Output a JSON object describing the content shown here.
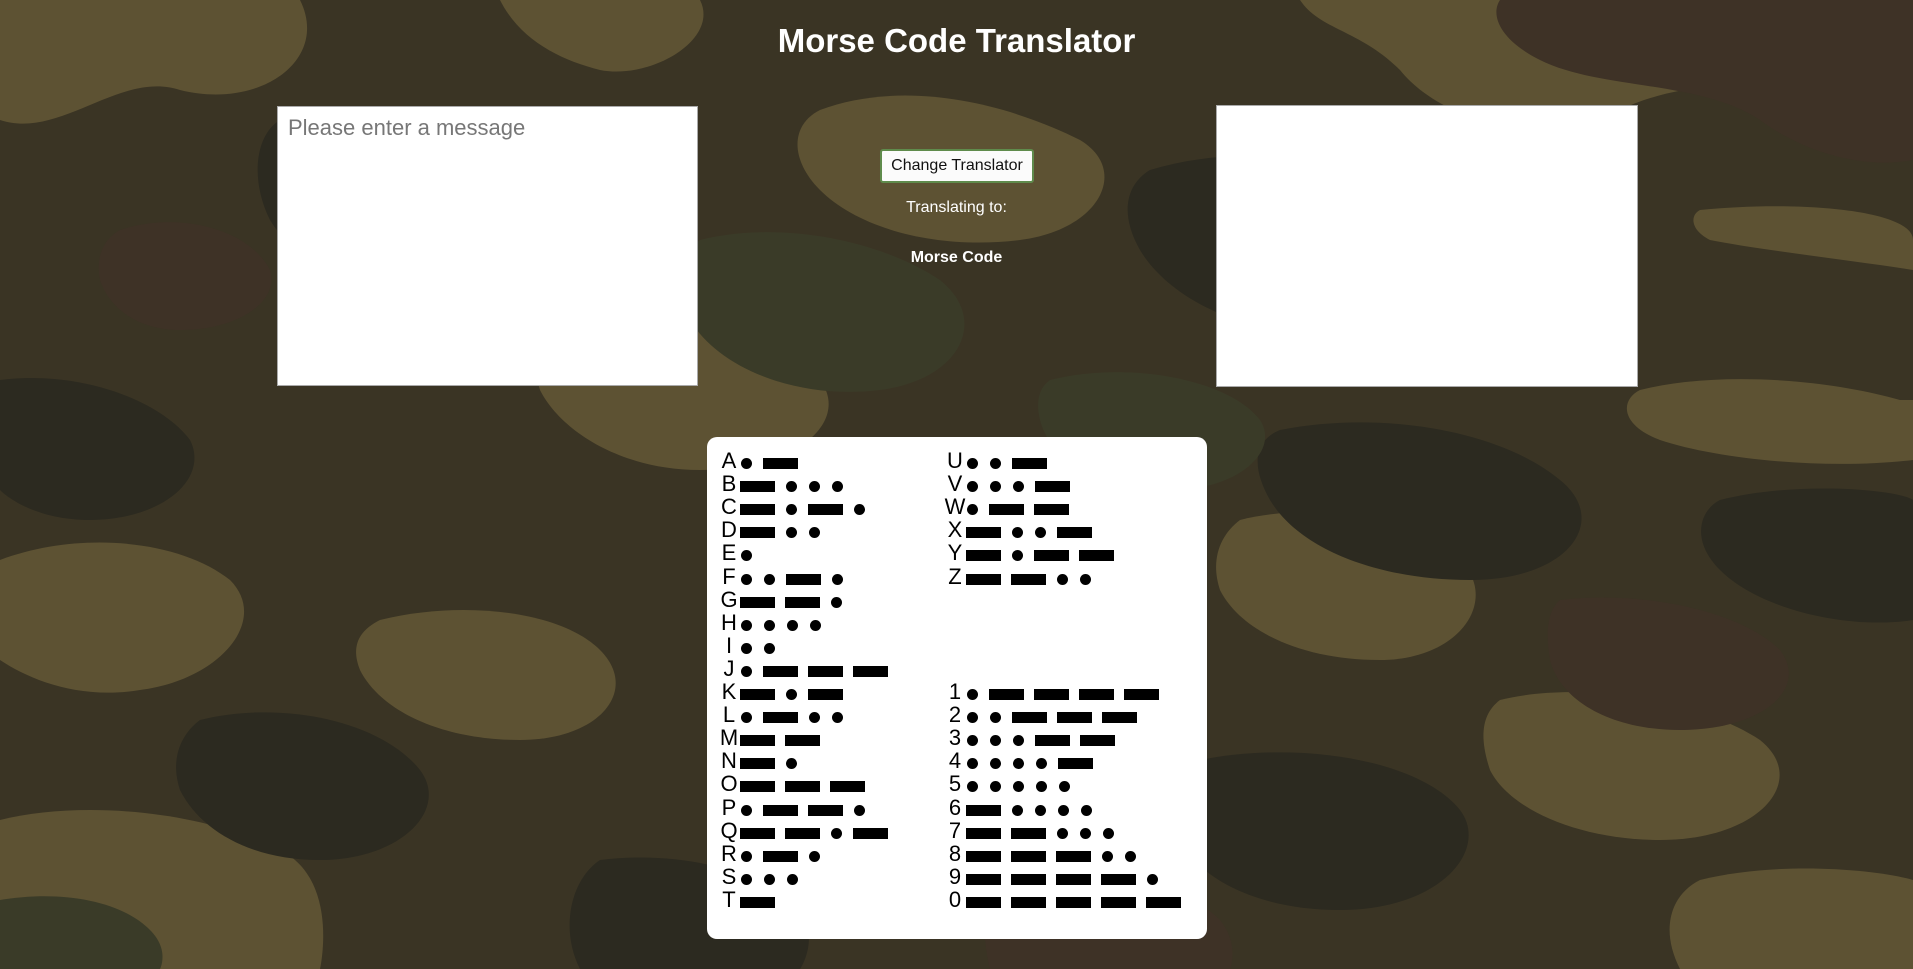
{
  "page": {
    "title": "Morse Code Translator"
  },
  "input": {
    "placeholder": "Please enter a message",
    "value": ""
  },
  "output": {
    "value": ""
  },
  "controls": {
    "change_button_label": "Change Translator",
    "translating_label": "Translating to:",
    "translating_target": "Morse Code"
  },
  "morse_chart": {
    "letters_left": [
      {
        "char": "A",
        "code": ".-"
      },
      {
        "char": "B",
        "code": "-..."
      },
      {
        "char": "C",
        "code": "-.-."
      },
      {
        "char": "D",
        "code": "-.."
      },
      {
        "char": "E",
        "code": "."
      },
      {
        "char": "F",
        "code": "..-."
      },
      {
        "char": "G",
        "code": "--."
      },
      {
        "char": "H",
        "code": "...."
      },
      {
        "char": "I",
        "code": ".."
      },
      {
        "char": "J",
        "code": ".---"
      },
      {
        "char": "K",
        "code": "-.-"
      },
      {
        "char": "L",
        "code": ".-.."
      },
      {
        "char": "M",
        "code": "--"
      },
      {
        "char": "N",
        "code": "-."
      },
      {
        "char": "O",
        "code": "---"
      },
      {
        "char": "P",
        "code": ".--."
      },
      {
        "char": "Q",
        "code": "--.-"
      },
      {
        "char": "R",
        "code": ".-."
      },
      {
        "char": "S",
        "code": "..."
      },
      {
        "char": "T",
        "code": "-"
      }
    ],
    "letters_right": [
      {
        "char": "U",
        "code": "..-"
      },
      {
        "char": "V",
        "code": "...-"
      },
      {
        "char": "W",
        "code": ".--"
      },
      {
        "char": "X",
        "code": "-..-"
      },
      {
        "char": "Y",
        "code": "-.--"
      },
      {
        "char": "Z",
        "code": "--.."
      }
    ],
    "digits": [
      {
        "char": "1",
        "code": ".----"
      },
      {
        "char": "2",
        "code": "..---"
      },
      {
        "char": "3",
        "code": "...--"
      },
      {
        "char": "4",
        "code": "....-"
      },
      {
        "char": "5",
        "code": "....."
      },
      {
        "char": "6",
        "code": "-...."
      },
      {
        "char": "7",
        "code": "--..."
      },
      {
        "char": "8",
        "code": "---.."
      },
      {
        "char": "9",
        "code": "----."
      },
      {
        "char": "0",
        "code": "-----"
      }
    ]
  },
  "colors": {
    "camo_base": "#3a3424",
    "camo_olive": "#5d5233",
    "camo_dark": "#2c2a20",
    "camo_brown": "#3e3226",
    "camo_green": "#3a3b28",
    "button_border": "#5f8b4c"
  }
}
